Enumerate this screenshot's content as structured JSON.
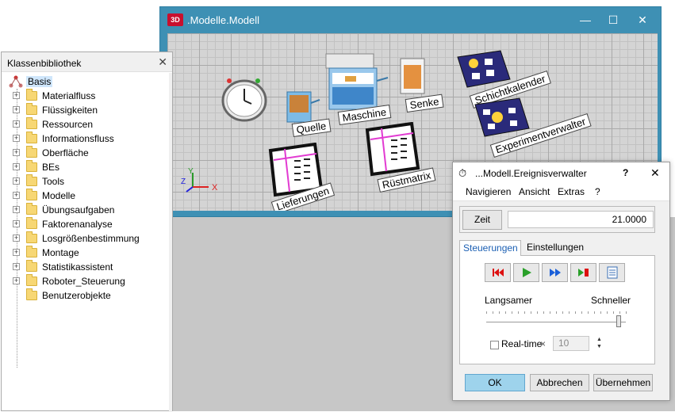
{
  "window3d": {
    "icon_text": "3D",
    "title": ".Modelle.Modell",
    "controls": {
      "minimize": "—",
      "maximize": "☐",
      "close": "✕"
    },
    "labels": {
      "quelle": "Quelle",
      "maschine": "Maschine",
      "senke": "Senke",
      "schichtkalender": "Schichtkalender",
      "experimentverwalter": "Experimentverwalter",
      "lieferungen": "Lieferungen",
      "ruestmatrix": "Rüstmatrix"
    },
    "axes": {
      "x": "X",
      "y": "Y",
      "z": "Z"
    }
  },
  "library": {
    "title": "Klassenbibliothek",
    "close": "✕",
    "root": "Basis",
    "items": [
      "Materialfluss",
      "Flüssigkeiten",
      "Ressourcen",
      "Informationsfluss",
      "Oberfläche",
      "BEs",
      "Tools",
      "Modelle",
      "Übungsaufgaben",
      "Faktorenanalyse",
      "Losgrößenbestimmung",
      "Montage",
      "Statistikassistent",
      "Roboter_Steuerung",
      "Benutzerobjekte"
    ]
  },
  "dialog": {
    "title": "...Modell.Ereignisverwalter",
    "help": "?",
    "close": "✕",
    "menu": [
      "Navigieren",
      "Ansicht",
      "Extras",
      "?"
    ],
    "zeit_button": "Zeit",
    "zeit_value": "21.0000",
    "tabs": [
      "Steuerungen",
      "Einstellungen"
    ],
    "speed": {
      "slower": "Langsamer",
      "faster": "Schneller",
      "level": 0.95
    },
    "realtime": {
      "label": "Real-time",
      "multiplier": "×",
      "value": "10",
      "checked": false
    },
    "buttons": {
      "ok": "OK",
      "cancel": "Abbrechen",
      "apply": "Übernehmen"
    },
    "colors": {
      "accent": "#1b5fb3",
      "ok_bg": "#9ed3ec",
      "window_blue": "#3e90b4"
    }
  }
}
